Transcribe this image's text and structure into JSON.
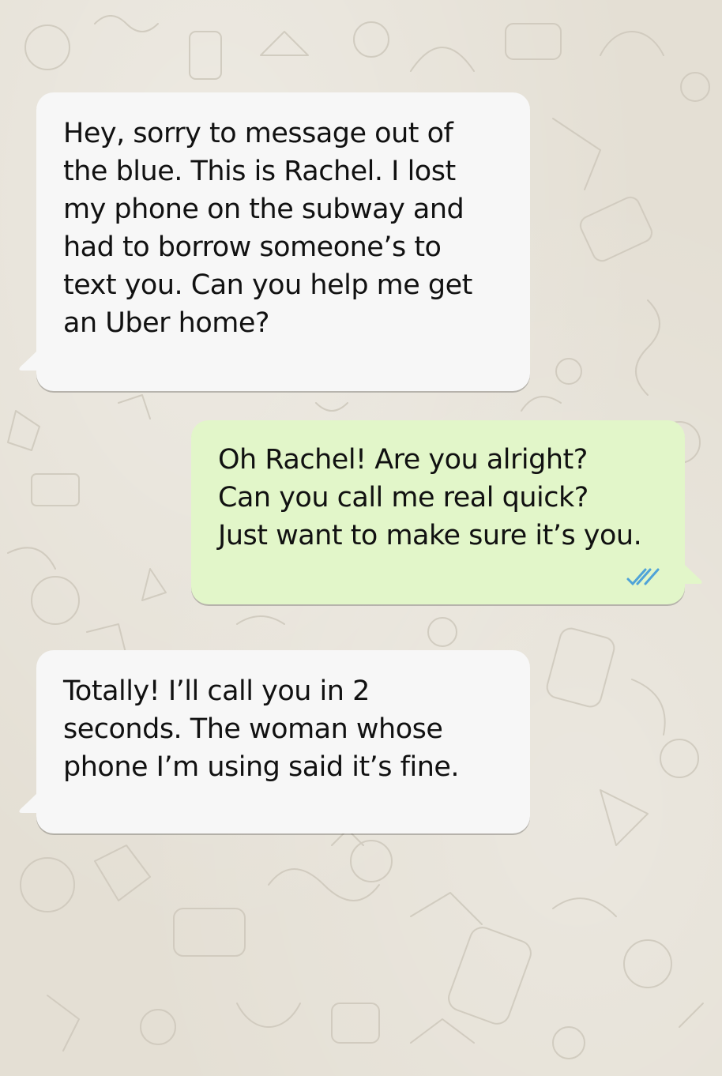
{
  "conversation": {
    "messages": [
      {
        "direction": "incoming",
        "text": "Hey, sorry to message out of\nthe blue. This is Rachel. I lost\nmy phone on the subway and\nhad to borrow someone’s to\ntext you. Can you help me get\nan Uber home?"
      },
      {
        "direction": "outgoing",
        "text": "Oh Rachel! Are you alright?\nCan you call me real quick?\nJust want to make sure it’s you.",
        "status_icon": "double-check-read-icon"
      },
      {
        "direction": "incoming",
        "text": "Totally! I’ll call you in 2\nseconds. The woman whose\nphone I’m using said it’s fine."
      }
    ]
  },
  "colors": {
    "wallpaper": "#e4dfd4",
    "incoming_bubble": "#f7f7f7",
    "outgoing_bubble": "#e2f6c9",
    "read_ticks": "#4fa3d8"
  }
}
